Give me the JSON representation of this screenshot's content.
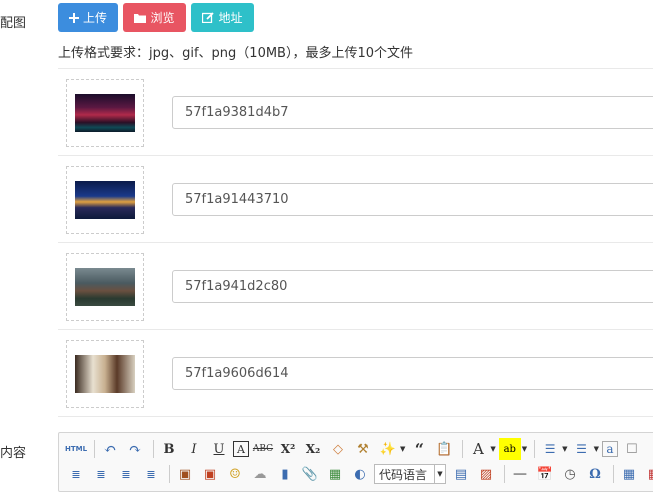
{
  "form": {
    "image_label": "配图",
    "content_label": "内容"
  },
  "upload": {
    "upload_label": "上传",
    "browse_label": "浏览",
    "address_label": "地址",
    "hint": "上传格式要求：jpg、gif、png（10MB），最多上传10个文件",
    "items": [
      {
        "value": "57f1a9381d4b7"
      },
      {
        "value": "57f1a91443710"
      },
      {
        "value": "57f1a941d2c80"
      },
      {
        "value": "57f1a9606d614"
      }
    ]
  },
  "editor": {
    "html_label": "HTML",
    "code_language": "代码语言"
  },
  "colors": {
    "upload": "#3c8dde",
    "browse": "#e85562",
    "address": "#2ec0c9"
  }
}
